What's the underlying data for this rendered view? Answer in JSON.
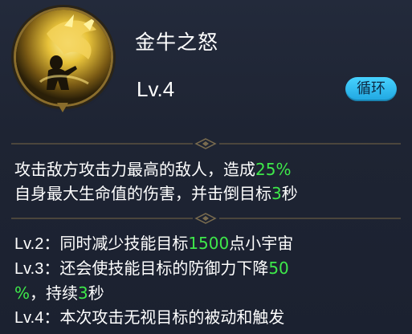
{
  "skill": {
    "name": "金牛之怒",
    "level": "Lv.4",
    "badge": "循环",
    "icon": "golden-bull-rage-icon"
  },
  "description": {
    "p1": "攻击敌方攻击力最高的敌人，造成",
    "v1": "25%",
    "p2": "自身最大生命值的伤害，并击倒目标",
    "v2": "3",
    "p3": "秒"
  },
  "levels": [
    {
      "tag": "Lv.2：",
      "a": "同时减少技能目标",
      "v": "1500",
      "b": "点小宇宙"
    },
    {
      "tag": "Lv.3：",
      "a": "还会使技能目标的防御力下降",
      "v": "50"
    },
    {
      "v": "%",
      "a": "，持续",
      "v2": "3",
      "b": "秒"
    },
    {
      "tag": "Lv.4：",
      "a": "本次攻击无视目标的被动和触发"
    }
  ],
  "colors": {
    "highlight": "#3ee84a",
    "badge": "#2fbdf2",
    "frame": "#8a6d2c"
  }
}
